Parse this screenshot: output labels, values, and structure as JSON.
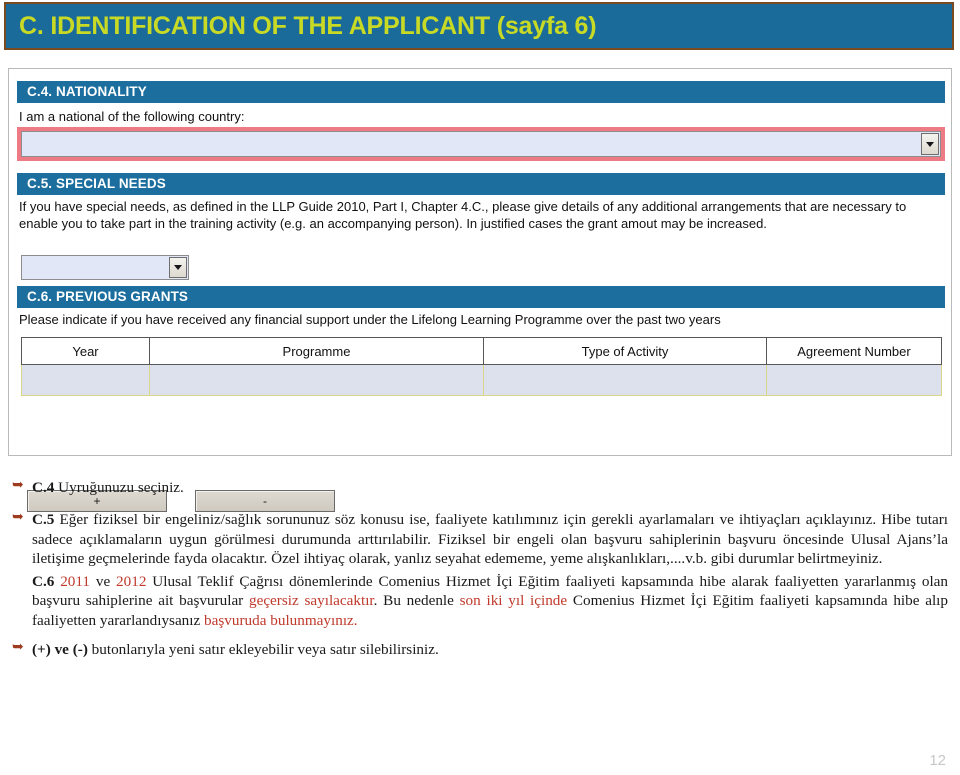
{
  "slide": {
    "title": "C. IDENTIFICATION OF THE APPLICANT (sayfa 6)",
    "page_number": "12",
    "accent_blue": "#1a6b99",
    "title_color": "#c9da25",
    "title_border": "#7a4a20",
    "section_header_blue": "#1b6e9e",
    "field_fill": "#e2e7f7",
    "highlight_red": "#ee7b84",
    "note_red": "#c0392b",
    "bullet_color": "#9e3b20"
  },
  "form": {
    "c4": {
      "header": "C.4. NATIONALITY",
      "label": "I am a national of the following country:",
      "dropdown_value": "",
      "dropdown_placeholder": ""
    },
    "c5": {
      "header": "C.5. SPECIAL NEEDS",
      "text": "If you have special needs, as defined in the LLP Guide 2010, Part I, Chapter 4.C., please give details of any additional arrangements that are necessary to enable you to take part in the training activity (e.g. an accompanying person). In justified cases the grant amout may be increased.",
      "dropdown_value": ""
    },
    "c6": {
      "header": "C.6. PREVIOUS GRANTS",
      "text": "Please indicate if you have received any financial support under the Lifelong Learning Programme over the past two years",
      "table": {
        "columns": [
          "Year",
          "Programme",
          "Type of Activity",
          "Agreement Number"
        ],
        "rows": [
          [
            "",
            "",
            "",
            ""
          ]
        ]
      },
      "add_button": "+",
      "remove_button": "-"
    }
  },
  "notes": {
    "c4": {
      "label": "C.4",
      "text": "Uyruğunuzu seçiniz."
    },
    "c5": {
      "label": "C.5",
      "text": "Eğer fiziksel bir engeliniz/sağlık sorununuz söz konusu ise, faaliyete katılımınız için gerekli ayarlamaları ve ihtiyaçları açıklayınız. Hibe tutarı sadece açıklamaların uygun görülmesi durumunda arttırılabilir. Fiziksel bir engeli olan başvuru sahiplerinin başvuru öncesinde Ulusal Ajans’la iletişime geçmelerinde fayda olacaktır. Özel ihtiyaç olarak, yanlız seyahat edememe, yeme alışkanlıkları,....v.b. gibi durumlar belirtmeyiniz."
    },
    "c6": {
      "label": "C.6",
      "year1": "2011",
      "mid1": " ve ",
      "year2": "2012",
      "part1": " Ulusal Teklif Çağrısı dönemlerinde Comenius Hizmet İçi Eğitim faaliyeti kapsamında hibe alarak faaliyetten yararlanmış olan başvuru sahiplerine ait başvurular ",
      "red1": "geçersiz sayılacaktır",
      "part2": ". Bu nedenle ",
      "red2": "son iki yıl içinde",
      "part3": " Comenius Hizmet İçi Eğitim faaliyeti kapsamında hibe alıp faaliyetten yararlandıysanız  ",
      "red3": "başvuruda bulunmayınız."
    },
    "buttons": {
      "bold": "(+) ve (-)",
      "text": " butonlarıyla yeni satır ekleyebilir veya satır silebilirsiniz."
    }
  }
}
